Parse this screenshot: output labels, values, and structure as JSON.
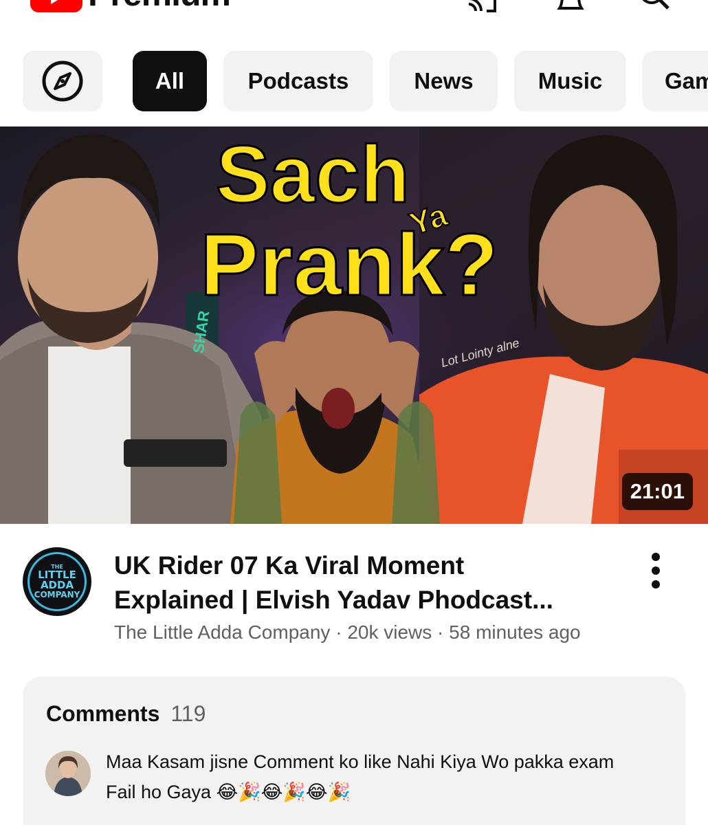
{
  "header": {
    "brand_word": "Premium",
    "icons": [
      "youtube-logo-icon",
      "cast-icon",
      "bell-icon",
      "search-icon"
    ]
  },
  "chips": {
    "explore_icon": "compass-icon",
    "items": [
      {
        "label": "All",
        "active": true
      },
      {
        "label": "Podcasts",
        "active": false
      },
      {
        "label": "News",
        "active": false
      },
      {
        "label": "Music",
        "active": false
      },
      {
        "label": "Gam",
        "active": false
      }
    ]
  },
  "video": {
    "thumbnail_text": {
      "word1": "Sach",
      "word2": "Ya",
      "word3": "Prank?",
      "jacket_text": "Lot Lointy alne",
      "sign_text": "SHAR"
    },
    "duration": "21:01",
    "title_line1": "UK Rider 07 Ka Viral Moment",
    "title_line2": "Explained | Elvish Yadav Phodcast...",
    "channel": "The Little Adda Company",
    "views": "20k views",
    "age": "58 minutes ago",
    "channel_avatar_text": [
      "THE",
      "LITTLE",
      "ADDA",
      "COMPANY"
    ],
    "menu_icon": "more-vertical-icon"
  },
  "comments": {
    "label": "Comments",
    "count": "119",
    "top_comment": "Maa Kasam jisne Comment ko like Nahi Kiya Wo pakka exam Fail ho Gaya 😂🎉😂🎉😂🎉"
  },
  "colors": {
    "youtube_red": "#ff0000",
    "chip_bg": "#f2f2f2",
    "chip_active_bg": "#0f0f0f",
    "secondary_text": "#606060",
    "thumbnail_text_yellow": "#ffe01b"
  }
}
